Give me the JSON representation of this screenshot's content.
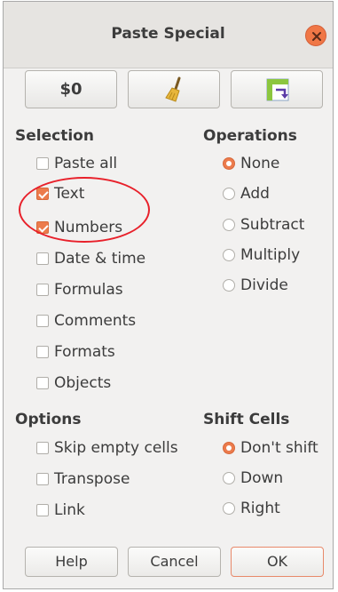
{
  "dialog": {
    "title": "Paste Special"
  },
  "toolbar": {
    "values_only_label": "$0",
    "clear_icon": "broom-icon",
    "transpose_icon": "table-transpose-icon"
  },
  "selection": {
    "heading": "Selection",
    "items": [
      {
        "label": "Paste all",
        "checked": false
      },
      {
        "label": "Text",
        "checked": true
      },
      {
        "label": "Numbers",
        "checked": true
      },
      {
        "label": "Date & time",
        "checked": false
      },
      {
        "label": "Formulas",
        "checked": false
      },
      {
        "label": "Comments",
        "checked": false
      },
      {
        "label": "Formats",
        "checked": false
      },
      {
        "label": "Objects",
        "checked": false
      }
    ]
  },
  "operations": {
    "heading": "Operations",
    "items": [
      {
        "label": "None",
        "selected": true
      },
      {
        "label": "Add",
        "selected": false
      },
      {
        "label": "Subtract",
        "selected": false
      },
      {
        "label": "Multiply",
        "selected": false
      },
      {
        "label": "Divide",
        "selected": false
      }
    ]
  },
  "options": {
    "heading": "Options",
    "items": [
      {
        "label": "Skip empty cells",
        "checked": false
      },
      {
        "label": "Transpose",
        "checked": false
      },
      {
        "label": "Link",
        "checked": false
      }
    ]
  },
  "shift_cells": {
    "heading": "Shift Cells",
    "items": [
      {
        "label": "Don't shift",
        "selected": true
      },
      {
        "label": "Down",
        "selected": false
      },
      {
        "label": "Right",
        "selected": false
      }
    ]
  },
  "buttons": {
    "help": "Help",
    "cancel": "Cancel",
    "ok": "OK"
  },
  "colors": {
    "accent": "#ec7b4c",
    "annotation": "#e8202a"
  }
}
